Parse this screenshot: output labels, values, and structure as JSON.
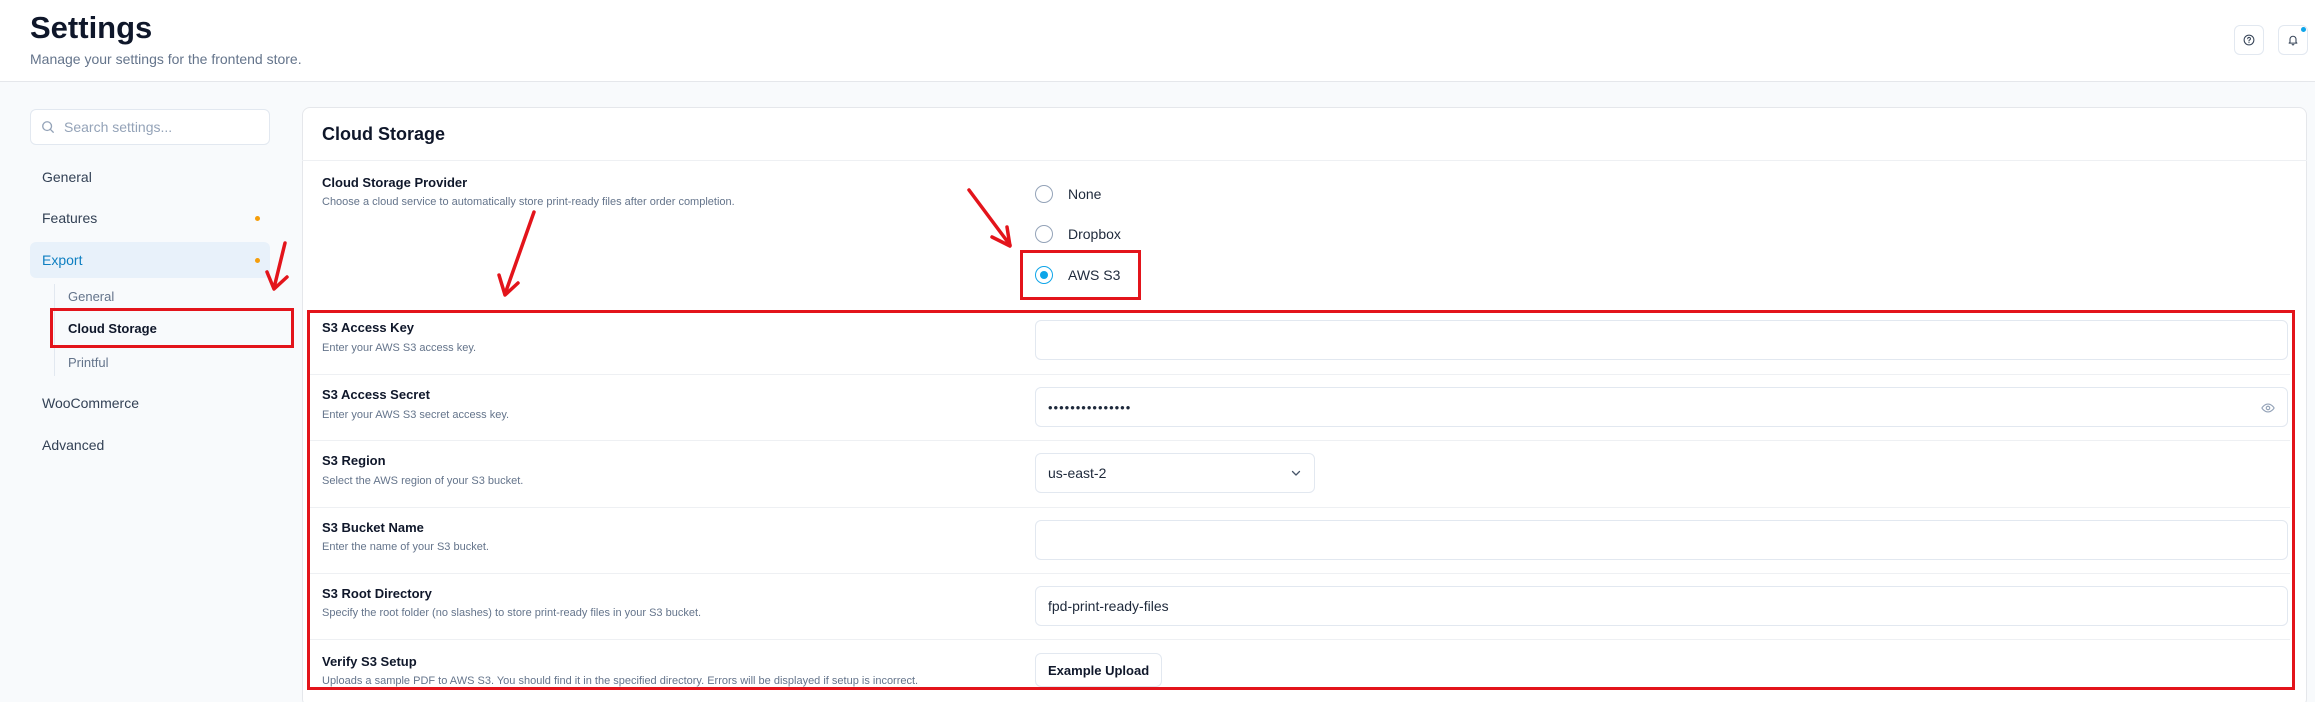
{
  "header": {
    "title": "Settings",
    "subtitle": "Manage your settings for the frontend store."
  },
  "sidebar": {
    "search_placeholder": "Search settings...",
    "items": [
      {
        "label": "General"
      },
      {
        "label": "Features"
      },
      {
        "label": "Export"
      },
      {
        "label": "WooCommerce"
      },
      {
        "label": "Advanced"
      }
    ],
    "export_sub_items": [
      {
        "label": "General"
      },
      {
        "label": "Cloud Storage"
      },
      {
        "label": "Printful"
      }
    ]
  },
  "main": {
    "title": "Cloud Storage",
    "provider": {
      "label": "Cloud Storage Provider",
      "description": "Choose a cloud service to automatically store print-ready files after order completion.",
      "options": [
        "None",
        "Dropbox",
        "AWS S3"
      ],
      "selected": "AWS S3"
    },
    "access_key": {
      "label": "S3 Access Key",
      "description": "Enter your AWS S3 access key.",
      "value": ""
    },
    "access_secret": {
      "label": "S3 Access Secret",
      "description": "Enter your AWS S3 secret access key.",
      "value": "•••••••••••••••"
    },
    "region": {
      "label": "S3 Region",
      "description": "Select the AWS region of your S3 bucket.",
      "value": "us-east-2"
    },
    "bucket": {
      "label": "S3 Bucket Name",
      "description": "Enter the name of your S3 bucket.",
      "value": ""
    },
    "root_dir": {
      "label": "S3 Root Directory",
      "description": "Specify the root folder (no slashes) to store print-ready files in your S3 bucket.",
      "value": "fpd-print-ready-files"
    },
    "verify": {
      "label": "Verify S3 Setup",
      "description": "Uploads a sample PDF to AWS S3. You should find it in the specified directory. Errors will be displayed if setup is incorrect.",
      "button_label": "Example Upload"
    }
  },
  "colors": {
    "accent": "#0ea5e9",
    "active_nav_text": "#0e7fc1",
    "badge_dot": "#f59e0b",
    "annotation": "#e3141b"
  }
}
